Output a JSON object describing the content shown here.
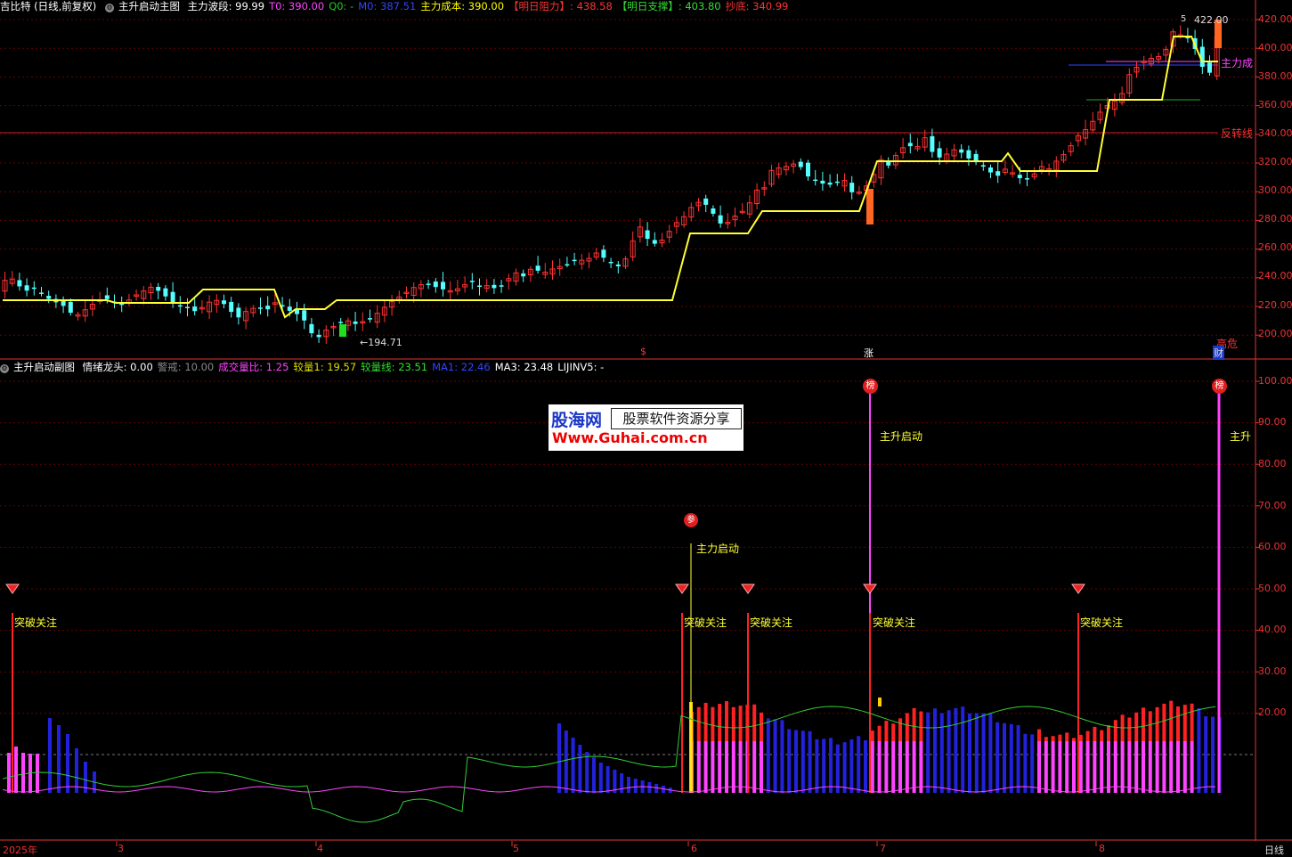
{
  "main_header": {
    "title": "吉比特 (日线,前复权)",
    "indicator": "主升启动主图",
    "items": [
      {
        "label": "主力波段: 99.99",
        "color": "#ffffff"
      },
      {
        "label": "T0: 390.00",
        "color": "#ff44ff"
      },
      {
        "label": "Q0: -",
        "color": "#22cc22"
      },
      {
        "label": "M0: 387.51",
        "color": "#3344ff"
      },
      {
        "label": "主力成本: 390.00",
        "color": "#ffff00"
      },
      {
        "label": "【明日阻力】: 438.58",
        "color": "#ff3333"
      },
      {
        "label": "【明日支撑】: 403.80",
        "color": "#33dd33"
      },
      {
        "label": "抄底: 340.99",
        "color": "#ff3333"
      }
    ]
  },
  "sub_header": {
    "indicator": "主升启动副图",
    "items": [
      {
        "label": "情绪龙头: 0.00",
        "color": "#ffffff"
      },
      {
        "label": "警戒: 10.00",
        "color": "#888888"
      },
      {
        "label": "成交量比: 1.25",
        "color": "#ff44ff"
      },
      {
        "label": "较量1: 19.57",
        "color": "#dddd00"
      },
      {
        "label": "较量线: 23.51",
        "color": "#33dd33"
      },
      {
        "label": "MA1: 22.46",
        "color": "#3344ff"
      },
      {
        "label": "MA3: 23.48",
        "color": "#ffffff"
      },
      {
        "label": "LIJINV5: -",
        "color": "#ffffff"
      }
    ]
  },
  "main_axis": [
    "420.00",
    "400.00",
    "380.00",
    "360.00",
    "340.00",
    "320.00",
    "300.00",
    "280.00",
    "260.00",
    "240.00",
    "220.00",
    "200.00"
  ],
  "sub_axis": [
    "100.00",
    "90.00",
    "80.00",
    "70.00",
    "60.00",
    "50.00",
    "40.00",
    "30.00",
    "20.00"
  ],
  "x_axis": [
    "2025年",
    "3",
    "4",
    "5",
    "6",
    "7",
    "8"
  ],
  "period_label": "日线",
  "annotations": {
    "low_price": "←194.71",
    "high_price": "422.00",
    "high_price_marker": "5",
    "main_cost_label": "主力成",
    "reversal_line": "反转线",
    "high_risk": "高危",
    "fin_mark": "财",
    "zhang_mark": "涨",
    "dollar_mark": "$",
    "breakout": "突破关注",
    "main_start": "主升启动",
    "main_force_start": "主力启动",
    "main_start_cut": "主升",
    "rank_icon": "榜",
    "join_icon": "参"
  },
  "watermark": {
    "name": "股海网",
    "tagline": "股票软件资源分享",
    "url": "Www.Guhai.com.cn"
  },
  "colors": {
    "up": "#ff3333",
    "down": "#55ffff",
    "mainline": "#ffff33",
    "grid": "#6a0000",
    "axis": "#e33333"
  }
}
